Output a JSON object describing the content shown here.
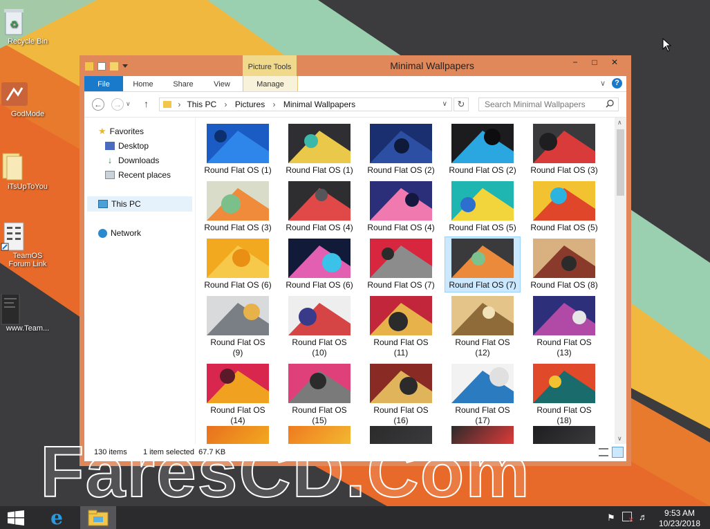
{
  "desktop": {
    "icons": [
      {
        "label": "Recycle Bin",
        "icon": "recycle-bin-icon"
      },
      {
        "label": "GodMode",
        "icon": "godmode-icon"
      },
      {
        "label": "iTsUpToYou",
        "icon": "folder-icon"
      },
      {
        "label": "TeamOS Forum Link",
        "icon": "shortcut-icon"
      },
      {
        "label": "www.Team...",
        "icon": "document-icon"
      }
    ]
  },
  "window": {
    "title": "Minimal Wallpapers",
    "context_tab": "Picture Tools",
    "ribbon_tabs": [
      "File",
      "Home",
      "Share",
      "View",
      "Manage"
    ],
    "controls": {
      "minimize": "−",
      "maximize": "□",
      "close": "✕"
    },
    "address": {
      "segments": [
        "This PC",
        "Pictures",
        "Minimal Wallpapers"
      ]
    },
    "search": {
      "placeholder": "Search Minimal Wallpapers"
    },
    "nav": {
      "favorites": "Favorites",
      "desktop": "Desktop",
      "downloads": "Downloads",
      "recent": "Recent places",
      "thispc": "This PC",
      "network": "Network"
    },
    "files": [
      {
        "label": "Round Flat OS (1)",
        "thumb": [
          "#1b5cc4",
          "#2f86ea",
          "#0c2f6e"
        ]
      },
      {
        "label": "Round Flat OS (1)",
        "thumb": [
          "#2f2f33",
          "#e9c84a",
          "#3bb8a8"
        ]
      },
      {
        "label": "Round Flat OS (2)",
        "thumb": [
          "#1a2f70",
          "#2c4fa3",
          "#0f1a3a"
        ]
      },
      {
        "label": "Round Flat OS (2)",
        "thumb": [
          "#1c1c1e",
          "#2aa6e0",
          "#0d0d0f"
        ]
      },
      {
        "label": "Round Flat OS (3)",
        "thumb": [
          "#3a3a3d",
          "#d93b3b",
          "#1e1e20"
        ]
      },
      {
        "label": "Round Flat OS (3)",
        "thumb": [
          "#d9dcc8",
          "#ef8b3a",
          "#7bbf8a"
        ]
      },
      {
        "label": "Round Flat OS (4)",
        "thumb": [
          "#2e2e31",
          "#e14848",
          "#55555a"
        ]
      },
      {
        "label": "Round Flat OS (4)",
        "thumb": [
          "#2b2f7a",
          "#f07ab0",
          "#15173f"
        ]
      },
      {
        "label": "Round Flat OS (5)",
        "thumb": [
          "#1fb5b0",
          "#f2d43c",
          "#2d6fcf"
        ]
      },
      {
        "label": "Round Flat OS (5)",
        "thumb": [
          "#f2c230",
          "#e0462a",
          "#2db3e0"
        ]
      },
      {
        "label": "Round Flat OS (6)",
        "thumb": [
          "#f2a91f",
          "#f7c94b",
          "#e98f14"
        ]
      },
      {
        "label": "Round Flat OS (6)",
        "thumb": [
          "#121a3a",
          "#e35fb2",
          "#3ac2e8"
        ]
      },
      {
        "label": "Round Flat OS (7)",
        "thumb": [
          "#d7263d",
          "#8c8c8c",
          "#2b2b2b"
        ]
      },
      {
        "label": "Round Flat OS (7)",
        "thumb": [
          "#3a3a3d",
          "#ea8a3a",
          "#7bc28f"
        ],
        "selected": true
      },
      {
        "label": "Round Flat OS (8)",
        "thumb": [
          "#d9b080",
          "#8a3a2a",
          "#2b2b2b"
        ]
      },
      {
        "label": "Round Flat OS (9)",
        "thumb": [
          "#d8dadb",
          "#7a7f86",
          "#e8b24a"
        ]
      },
      {
        "label": "Round Flat OS (10)",
        "thumb": [
          "#eeeeee",
          "#d64545",
          "#3a3a8a"
        ]
      },
      {
        "label": "Round Flat OS (11)",
        "thumb": [
          "#c2263a",
          "#e8b24a",
          "#2b2b2b"
        ]
      },
      {
        "label": "Round Flat OS (12)",
        "thumb": [
          "#e5c48a",
          "#8f6b3a",
          "#f2e2b8"
        ]
      },
      {
        "label": "Round Flat OS (13)",
        "thumb": [
          "#2e2f7a",
          "#b04aa6",
          "#e6e6e6"
        ]
      },
      {
        "label": "Round Flat OS (14)",
        "thumb": [
          "#d9264f",
          "#f0a11f",
          "#5a1a2a"
        ]
      },
      {
        "label": "Round Flat OS (15)",
        "thumb": [
          "#e0407a",
          "#7a7a7a",
          "#2b2b2b"
        ]
      },
      {
        "label": "Round Flat OS (16)",
        "thumb": [
          "#8a2a24",
          "#e0b45a",
          "#2b2b2b"
        ]
      },
      {
        "label": "Round Flat OS (17)",
        "thumb": [
          "#f2f2f2",
          "#2a7bbf",
          "#e0e0e0"
        ]
      },
      {
        "label": "Round Flat OS (18)",
        "thumb": [
          "#e04a2a",
          "#1a6b6b",
          "#f2c230"
        ]
      }
    ],
    "partial_row": [
      [
        "#e8701f",
        "#f2a91f"
      ],
      [
        "#f07a1f",
        "#f2b830"
      ],
      [
        "#2b2b2b",
        "#3a3a3d"
      ],
      [
        "#2b2b2b",
        "#e03a3a"
      ],
      [
        "#1e1e20",
        "#3a3a3d"
      ]
    ],
    "status": {
      "count": "130 items",
      "selection": "1 item selected  67.7 KB"
    }
  },
  "taskbar": {
    "time": "9:53 AM",
    "date": "10/23/2018"
  },
  "watermark": "FaresCD.Com",
  "colors": {
    "window_frame": "#e1885a",
    "file_tab": "#1979ca",
    "context_tab": "#f1d98c",
    "selection": "#cce8ff",
    "taskbar": "#2b2b2d"
  }
}
